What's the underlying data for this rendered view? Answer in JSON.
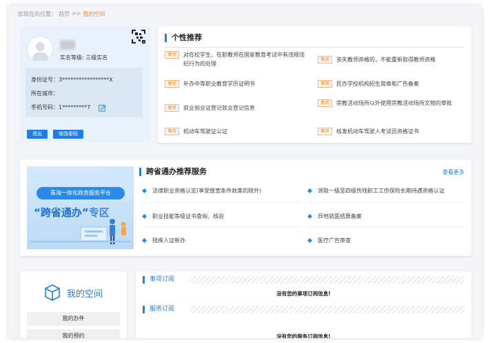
{
  "breadcrumb": {
    "prefix": "您现在的位置：",
    "home": "首页",
    "sep": ">>",
    "current": "我的空间"
  },
  "user": {
    "level": "实名等级: 三级实名",
    "id_label": "身份证号：",
    "id_value": "3*****************X",
    "city_label": "所在城市：",
    "city_value": "",
    "phone_label": "手机号码：",
    "phone_value": "1*********7",
    "logout": "退出",
    "change_password": "修改密码"
  },
  "recommend": {
    "title": "个性推荐",
    "tag": "事项",
    "items": [
      "对在校学生、在职教师在国家教育考试中有违规违纪行为的处理",
      "丧失教师资格的，不能重新取得教师资格",
      "补办中等职业教育学历证明书",
      "民办学校机构招生简章和广告备案",
      "就业创业证登记就业登记信息",
      "宗教活动场所以外使用宗教活动场所文物的审批",
      "机动车驾驶证公证",
      "核发机动车驾驶人考试员资格证书"
    ]
  },
  "cross": {
    "banner_pill": "青海一体化政务服务平台",
    "banner_main": "“跨省通办”",
    "banner_zone": "专区",
    "title": "跨省通办推荐服务",
    "more": "查看更多",
    "items": [
      "法律职业资格认定(享受放宽条件政策的除外)",
      "领取一级至四级伤残职工工伤保险长期待遇资格认证",
      "职业技能等级证书查询、核验",
      "异地就医结算备案",
      "残疾人证新办",
      "医疗广告审查"
    ]
  },
  "space": {
    "title": "我的空间",
    "items": [
      "我的办件",
      "我的预约"
    ]
  },
  "subscriptions": {
    "item_title": "事项订阅",
    "item_msg": "没有您的事项订阅信息!",
    "service_title": "服务订阅",
    "service_msg": "没有您的服务订阅信息!"
  }
}
